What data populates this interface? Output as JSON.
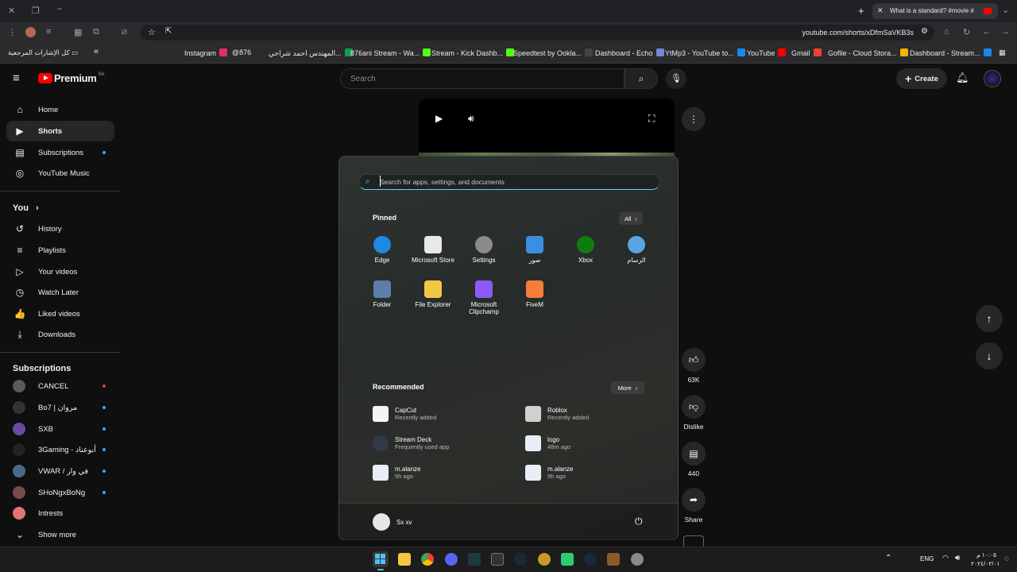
{
  "browser": {
    "tab_title": "What is a standard? #movie #",
    "url": "youtube.com/shorts/xDfmSaVKB3s",
    "new_tab": "+",
    "bookmarks_folder": "كل الإشارات المرجعية",
    "bookmarks": [
      {
        "label": "Instagram",
        "color": "#e1306c"
      },
      {
        "label": "@876",
        "color": ""
      },
      {
        "label": "المهندس احمد شراحي...",
        "color": "#0f9d58"
      },
      {
        "label": "876ani Stream - Wa...",
        "color": "#53fc18"
      },
      {
        "label": "Stream - Kick Dashb...",
        "color": "#53fc18"
      },
      {
        "label": "Speedtest by Ookla...",
        "color": "#444"
      },
      {
        "label": "Dashboard - Echo",
        "color": "#7289da"
      },
      {
        "label": "YtMp3 - YouTube to...",
        "color": "#1e88e5"
      },
      {
        "label": "YouTube",
        "color": "#ff0000"
      },
      {
        "label": "Gmail",
        "color": "#ea4335"
      },
      {
        "label": "Gofile - Cloud Stora...",
        "color": "#f4b400"
      },
      {
        "label": "Dashboard - Stream...",
        "color": "#1e88e5"
      }
    ]
  },
  "yt": {
    "logo": "Premium",
    "region": "SA",
    "search_placeholder": "Search",
    "create_label": "Create",
    "sidebar_main": [
      {
        "label": "Home",
        "icon": "home-icon",
        "glyph": "⌂"
      },
      {
        "label": "Shorts",
        "icon": "shorts-icon",
        "glyph": "▶"
      },
      {
        "label": "Subscriptions",
        "icon": "subscriptions-icon",
        "glyph": "▤"
      },
      {
        "label": "YouTube Music",
        "icon": "music-icon",
        "glyph": "◎"
      }
    ],
    "you_label": "You",
    "sidebar_you": [
      {
        "label": "History",
        "icon": "history-icon",
        "glyph": "↺"
      },
      {
        "label": "Playlists",
        "icon": "playlists-icon",
        "glyph": "≡"
      },
      {
        "label": "Your videos",
        "icon": "your-videos-icon",
        "glyph": "▷"
      },
      {
        "label": "Watch Later",
        "icon": "watch-later-icon",
        "glyph": "◷"
      },
      {
        "label": "Liked videos",
        "icon": "liked-videos-icon",
        "glyph": "👍"
      },
      {
        "label": "Downloads",
        "icon": "downloads-icon",
        "glyph": "⤓"
      }
    ],
    "subscriptions_label": "Subscriptions",
    "subscriptions": [
      {
        "label": "CANCEL",
        "color": "#5a5a5a",
        "dot": "#e53935"
      },
      {
        "label": "Bo7 | مروان",
        "color": "#333",
        "dot": "#3ea6ff"
      },
      {
        "label": "SXB",
        "color": "#6b4aa0",
        "dot": "#3ea6ff"
      },
      {
        "label": "3Gaming - أبوعناد",
        "color": "#222",
        "dot": "#3ea6ff"
      },
      {
        "label": "VWAR / في وار",
        "color": "#4a6a8a",
        "dot": "#3ea6ff"
      },
      {
        "label": "SHoNgxBoNg",
        "color": "#7a4a4a",
        "dot": "#3ea6ff"
      },
      {
        "label": "Intrests",
        "color": "#e57373",
        "dot": ""
      }
    ],
    "show_more": "Show more",
    "likes": "63K",
    "dislike": "Dislike",
    "comments": "440",
    "share": "Share"
  },
  "start": {
    "search_placeholder": "Search for apps, settings, and documents",
    "pinned_label": "Pinned",
    "all_label": "All",
    "pinned": [
      {
        "label": "Edge",
        "icon": "edge-icon",
        "color": "#1e88e5"
      },
      {
        "label": "Microsoft Store",
        "icon": "store-icon",
        "color": "#e8e8e8"
      },
      {
        "label": "Settings",
        "icon": "settings-icon",
        "color": "#8a8a8a"
      },
      {
        "label": "صور",
        "icon": "photos-icon",
        "color": "#3b8fe0"
      },
      {
        "label": "Xbox",
        "icon": "xbox-icon",
        "color": "#107c10"
      },
      {
        "label": "الرسام",
        "icon": "paint-icon",
        "color": "#5aa5e0"
      },
      {
        "label": "Folder",
        "icon": "folder-icon",
        "color": "#5b7fa8"
      },
      {
        "label": "File Explorer",
        "icon": "file-explorer-icon",
        "color": "#f2c744"
      },
      {
        "label": "Microsoft Clipchamp",
        "icon": "clipchamp-icon",
        "color": "#8a5cf5"
      },
      {
        "label": "FiveM",
        "icon": "fivem-icon",
        "color": "#f57c3a"
      }
    ],
    "recommended_label": "Recommended",
    "more_label": "More",
    "recommended": [
      {
        "name": "CapCut",
        "sub": "Recently added",
        "icon": "capcut-icon",
        "color": "#f5f5f5"
      },
      {
        "name": "Roblox",
        "sub": "Recently added",
        "icon": "roblox-icon",
        "color": "#d0d0d0"
      },
      {
        "name": "Stream Deck",
        "sub": "Frequently used app",
        "icon": "stream-deck-icon",
        "color": "#303a48"
      },
      {
        "name": "logo",
        "sub": "48m ago",
        "icon": "image-file-icon",
        "color": "#e8eef6"
      },
      {
        "name": "m.alanze",
        "sub": "5h ago",
        "icon": "image-file-icon",
        "color": "#e8eef6"
      },
      {
        "name": "m.alanze",
        "sub": "5h ago",
        "icon": "image-file-icon",
        "color": "#e8eef6"
      }
    ],
    "user_name": "Sx xv"
  },
  "taskbar": {
    "lang": "ENG",
    "time": "١٠:٠٥ م",
    "date": "٢٠٢٤/٠٢/٠١"
  }
}
